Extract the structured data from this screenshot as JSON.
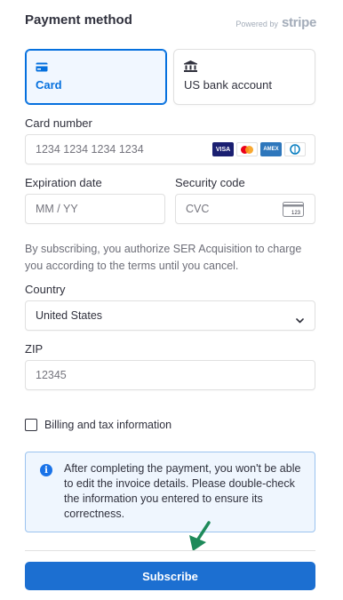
{
  "header": {
    "title": "Payment method",
    "powered_by": "Powered by",
    "brand": "stripe"
  },
  "methods": [
    {
      "label": "Card",
      "selected": true,
      "icon": "card-icon"
    },
    {
      "label": "US bank account",
      "selected": false,
      "icon": "bank-icon"
    }
  ],
  "card_number": {
    "label": "Card number",
    "placeholder": "1234 1234 1234 1234",
    "brands": [
      "VISA",
      "mastercard",
      "AMEX",
      "diners"
    ]
  },
  "expiration": {
    "label": "Expiration date",
    "placeholder": "MM / YY"
  },
  "security": {
    "label": "Security code",
    "placeholder": "CVC",
    "icon_text": "123"
  },
  "terms": "By subscribing, you authorize SER Acquisition to charge you according to the terms until you cancel.",
  "country": {
    "label": "Country",
    "value": "United States"
  },
  "zip": {
    "label": "ZIP",
    "placeholder": "12345"
  },
  "billing_checkbox": {
    "label": "Billing and tax information",
    "checked": false
  },
  "notice": {
    "icon": "info-icon",
    "text": "After completing the payment, you won't be able to edit the invoice details. Please double-check the information you entered to ensure its correctness."
  },
  "subscribe_button": "Subscribe",
  "colors": {
    "accent": "#0570de",
    "button": "#1c6fd1",
    "notice_bg": "#eff6fe",
    "arrow": "#1e8a5a"
  }
}
